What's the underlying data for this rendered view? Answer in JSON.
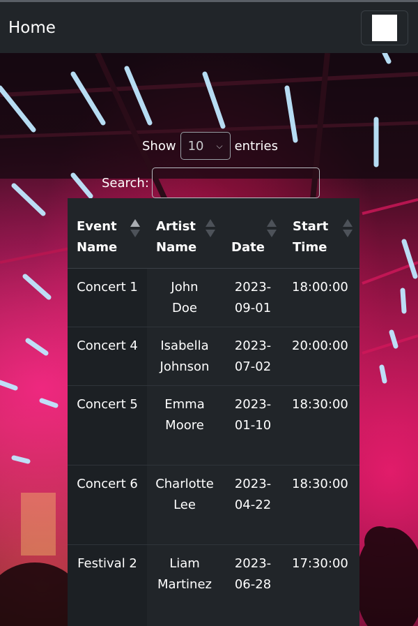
{
  "navbar": {
    "brand": "Home"
  },
  "datatable": {
    "length_label_before": "Show",
    "length_value": "10",
    "length_label_after": "entries",
    "search_label": "Search:",
    "search_value": ""
  },
  "table": {
    "headers": [
      {
        "line1": "Event",
        "line2": "Name"
      },
      {
        "line1": "Artist",
        "line2": "Name"
      },
      {
        "line1": "",
        "line2": "Date"
      },
      {
        "line1": "Start",
        "line2": "Time"
      }
    ],
    "rows": [
      {
        "event": "Concert 1",
        "artist1": "John",
        "artist2": "Doe",
        "date1": "2023-",
        "date2": "09-01",
        "time": "18:00:00"
      },
      {
        "event": "Concert 4",
        "artist1": "Isabella",
        "artist2": "Johnson",
        "date1": "2023-",
        "date2": "07-02",
        "time": "20:00:00"
      },
      {
        "event": "Concert 5",
        "artist1": "Emma",
        "artist2": "Moore",
        "date1": "2023-",
        "date2": "01-10",
        "time": "18:30:00"
      },
      {
        "event": "Concert 6",
        "artist1": "Charlotte",
        "artist2": "Lee",
        "date1": "2023-",
        "date2": "04-22",
        "time": "18:30:00"
      },
      {
        "event": "Festival 2",
        "artist1": "Liam",
        "artist2": "Martinez",
        "date1": "2023-",
        "date2": "06-28",
        "time": "17:30:00"
      }
    ]
  },
  "icons": {
    "menu": "hamburger-icon",
    "select_caret": "chevron-down-icon",
    "sort": "sort-arrows-icon"
  }
}
